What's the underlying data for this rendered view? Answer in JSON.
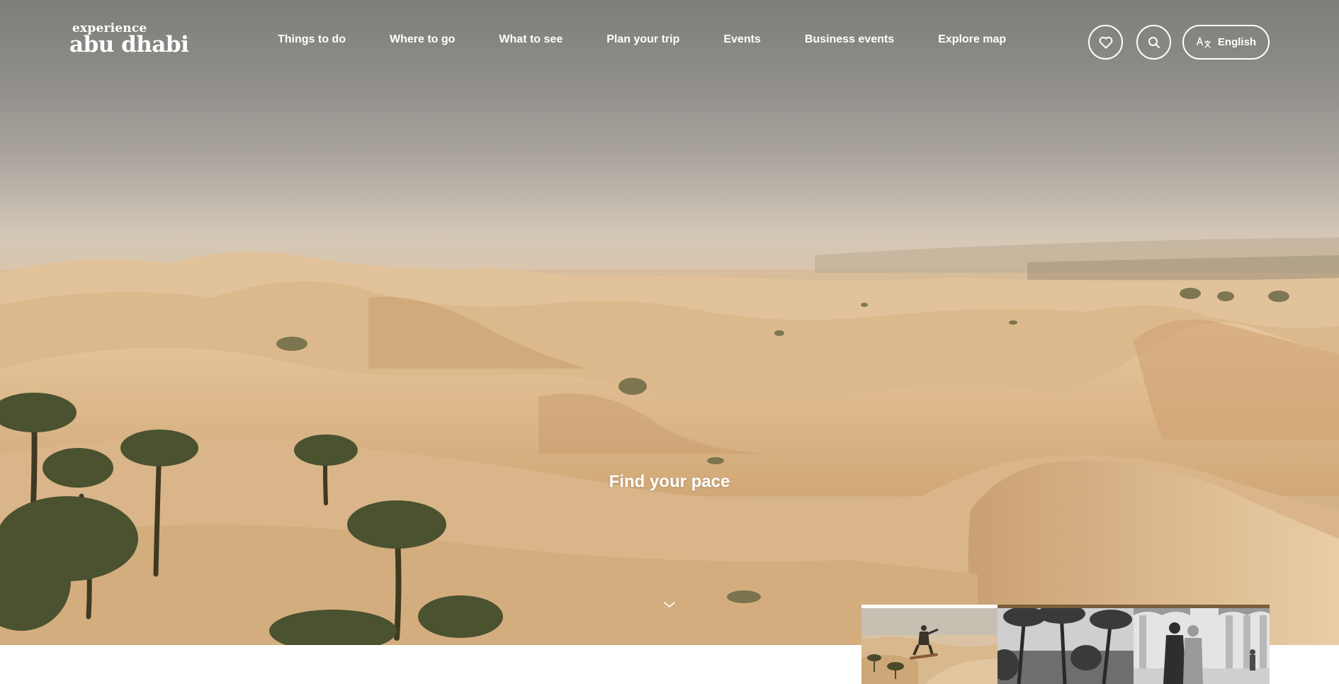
{
  "header": {
    "logo": {
      "small": "experience",
      "big": "abu dhabi"
    },
    "nav": [
      {
        "label": "Things to do"
      },
      {
        "label": "Where to go"
      },
      {
        "label": "What to see"
      },
      {
        "label": "Plan your trip"
      },
      {
        "label": "Events"
      },
      {
        "label": "Business events"
      },
      {
        "label": "Explore map"
      }
    ],
    "favorites_icon": "heart-icon",
    "search_icon": "search-icon",
    "language": {
      "icon": "translate-icon",
      "label": "English"
    }
  },
  "hero": {
    "tagline": "Find your pace",
    "scroll_icon": "chevron-down-icon"
  },
  "carousel": {
    "active_index": 0,
    "thumbnails": [
      {
        "name": "sandboarding",
        "tone": "color"
      },
      {
        "name": "palm-oasis",
        "tone": "monochrome"
      },
      {
        "name": "mosque-couple",
        "tone": "monochrome"
      }
    ]
  },
  "colors": {
    "nav_text": "#ffffff",
    "sand": "#d9b88b",
    "sky": "#8c8a86",
    "progress_track": "#7a5d3a",
    "progress_fill": "#ffffff"
  }
}
